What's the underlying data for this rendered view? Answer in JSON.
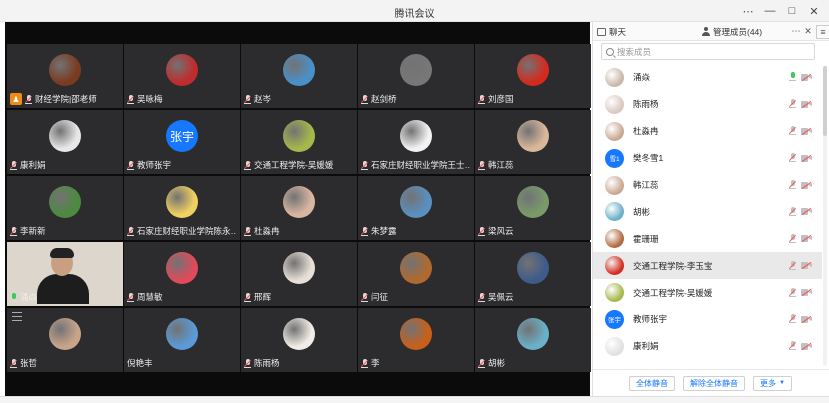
{
  "window": {
    "title": "腾讯会议",
    "controls": {
      "more": "⋯",
      "minimize": "—",
      "maximize": "□",
      "close": "✕"
    }
  },
  "colors": {
    "accent": "#1677ff",
    "host_badge": "#f08c14",
    "mic_active": "#3cc95e",
    "muted": "#ff4d4f"
  },
  "video_tiles": [
    {
      "name": "财经学院|邵老师",
      "host": true,
      "avatar_color": "#7a3b20"
    },
    {
      "name": "吴咏梅",
      "avatar_color": "#c02b2b"
    },
    {
      "name": "赵岑",
      "avatar_color": "#4a90c8"
    },
    {
      "name": "赵剑桥",
      "avatar_color": "#777777"
    },
    {
      "name": "刘彦国",
      "avatar_color": "#d42a1e"
    },
    {
      "name": "康利娟",
      "avatar_color": "#e8e8e8"
    },
    {
      "name": "教师张宇",
      "avatar_text": "张宇",
      "avatar_color": "#1677ff"
    },
    {
      "name": "交通工程学院-吴媛媛",
      "avatar_color": "#a5b84a"
    },
    {
      "name": "石家庄财经职业学院王士…",
      "avatar_color": "#f2f2f2"
    },
    {
      "name": "韩江蕊",
      "avatar_color": "#d9b89a"
    },
    {
      "name": "李新新",
      "avatar_color": "#4c8a3f"
    },
    {
      "name": "石家庄财经职业学院陈永…",
      "avatar_color": "#f0d060"
    },
    {
      "name": "杜淼冉",
      "avatar_color": "#d9b6a0"
    },
    {
      "name": "朱梦露",
      "avatar_color": "#5a8fbf"
    },
    {
      "name": "梁风云",
      "avatar_color": "#7a9a6a"
    },
    {
      "name": "涌焱",
      "video": true,
      "mic_active": true
    },
    {
      "name": "周慧敏",
      "avatar_color": "#e04a5a"
    },
    {
      "name": "邢辉",
      "avatar_color": "#e8e0d8"
    },
    {
      "name": "闫征",
      "avatar_color": "#b06a30"
    },
    {
      "name": "吴佩云",
      "avatar_color": "#3e5c8a"
    },
    {
      "name": "张哲",
      "avatar_color": "#c8a48a"
    },
    {
      "name": "倪艳丰",
      "avatar_color": "#5a9ad8",
      "no_mic": true
    },
    {
      "name": "陈雨杨",
      "avatar_color": "#f2ece6"
    },
    {
      "name": "李",
      "avatar_color": "#c8601a"
    },
    {
      "name": "胡彬",
      "avatar_color": "#6ab0c8"
    }
  ],
  "panel": {
    "tab_chat": "聊天",
    "tab_members": "管理成员(44)",
    "tab_more": "⋯",
    "tab_close": "✕",
    "tab_menu": "≡",
    "search_placeholder": "搜索成员",
    "members": [
      {
        "name": "涌焱",
        "mic_on": true,
        "avatar_color": "#c8b8a8"
      },
      {
        "name": "陈雨杨",
        "avatar_color": "#d8c8c0"
      },
      {
        "name": "杜淼冉",
        "avatar_color": "#c9a890"
      },
      {
        "name": "樊冬雪1",
        "avatar_text": "雪1",
        "avatar_color": "#1677ff"
      },
      {
        "name": "韩江蕊",
        "avatar_color": "#c8a890"
      },
      {
        "name": "胡彬",
        "avatar_color": "#6ab0c8"
      },
      {
        "name": "霍珊珊",
        "avatar_color": "#b06a40"
      },
      {
        "name": "交通工程学院-李玉宝",
        "avatar_color": "#d42a1e",
        "selected": true
      },
      {
        "name": "交通工程学院-吴媛媛",
        "avatar_color": "#a5b84a"
      },
      {
        "name": "教师张宇",
        "avatar_text": "张宇",
        "avatar_color": "#1677ff"
      },
      {
        "name": "康利娟",
        "avatar_color": "#e0e0e0"
      }
    ],
    "footer": {
      "mute_all": "全体静音",
      "unmute_all": "解除全体静音",
      "more": "更多",
      "more_caret": "▼"
    }
  }
}
